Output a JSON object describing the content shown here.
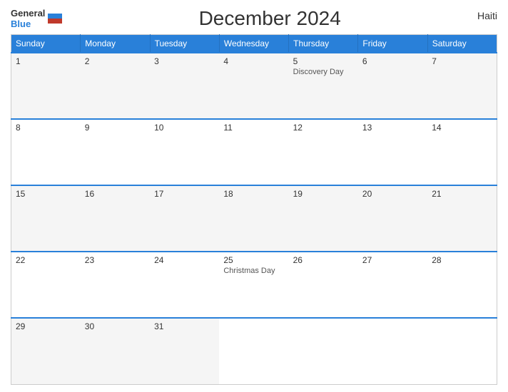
{
  "header": {
    "title": "December 2024",
    "country": "Haiti",
    "logo_general": "General",
    "logo_blue": "Blue"
  },
  "weekdays": [
    "Sunday",
    "Monday",
    "Tuesday",
    "Wednesday",
    "Thursday",
    "Friday",
    "Saturday"
  ],
  "weeks": [
    [
      {
        "day": "1",
        "holiday": ""
      },
      {
        "day": "2",
        "holiday": ""
      },
      {
        "day": "3",
        "holiday": ""
      },
      {
        "day": "4",
        "holiday": ""
      },
      {
        "day": "5",
        "holiday": "Discovery Day"
      },
      {
        "day": "6",
        "holiday": ""
      },
      {
        "day": "7",
        "holiday": ""
      }
    ],
    [
      {
        "day": "8",
        "holiday": ""
      },
      {
        "day": "9",
        "holiday": ""
      },
      {
        "day": "10",
        "holiday": ""
      },
      {
        "day": "11",
        "holiday": ""
      },
      {
        "day": "12",
        "holiday": ""
      },
      {
        "day": "13",
        "holiday": ""
      },
      {
        "day": "14",
        "holiday": ""
      }
    ],
    [
      {
        "day": "15",
        "holiday": ""
      },
      {
        "day": "16",
        "holiday": ""
      },
      {
        "day": "17",
        "holiday": ""
      },
      {
        "day": "18",
        "holiday": ""
      },
      {
        "day": "19",
        "holiday": ""
      },
      {
        "day": "20",
        "holiday": ""
      },
      {
        "day": "21",
        "holiday": ""
      }
    ],
    [
      {
        "day": "22",
        "holiday": ""
      },
      {
        "day": "23",
        "holiday": ""
      },
      {
        "day": "24",
        "holiday": ""
      },
      {
        "day": "25",
        "holiday": "Christmas Day"
      },
      {
        "day": "26",
        "holiday": ""
      },
      {
        "day": "27",
        "holiday": ""
      },
      {
        "day": "28",
        "holiday": ""
      }
    ],
    [
      {
        "day": "29",
        "holiday": ""
      },
      {
        "day": "30",
        "holiday": ""
      },
      {
        "day": "31",
        "holiday": ""
      },
      {
        "day": "",
        "holiday": ""
      },
      {
        "day": "",
        "holiday": ""
      },
      {
        "day": "",
        "holiday": ""
      },
      {
        "day": "",
        "holiday": ""
      }
    ]
  ]
}
